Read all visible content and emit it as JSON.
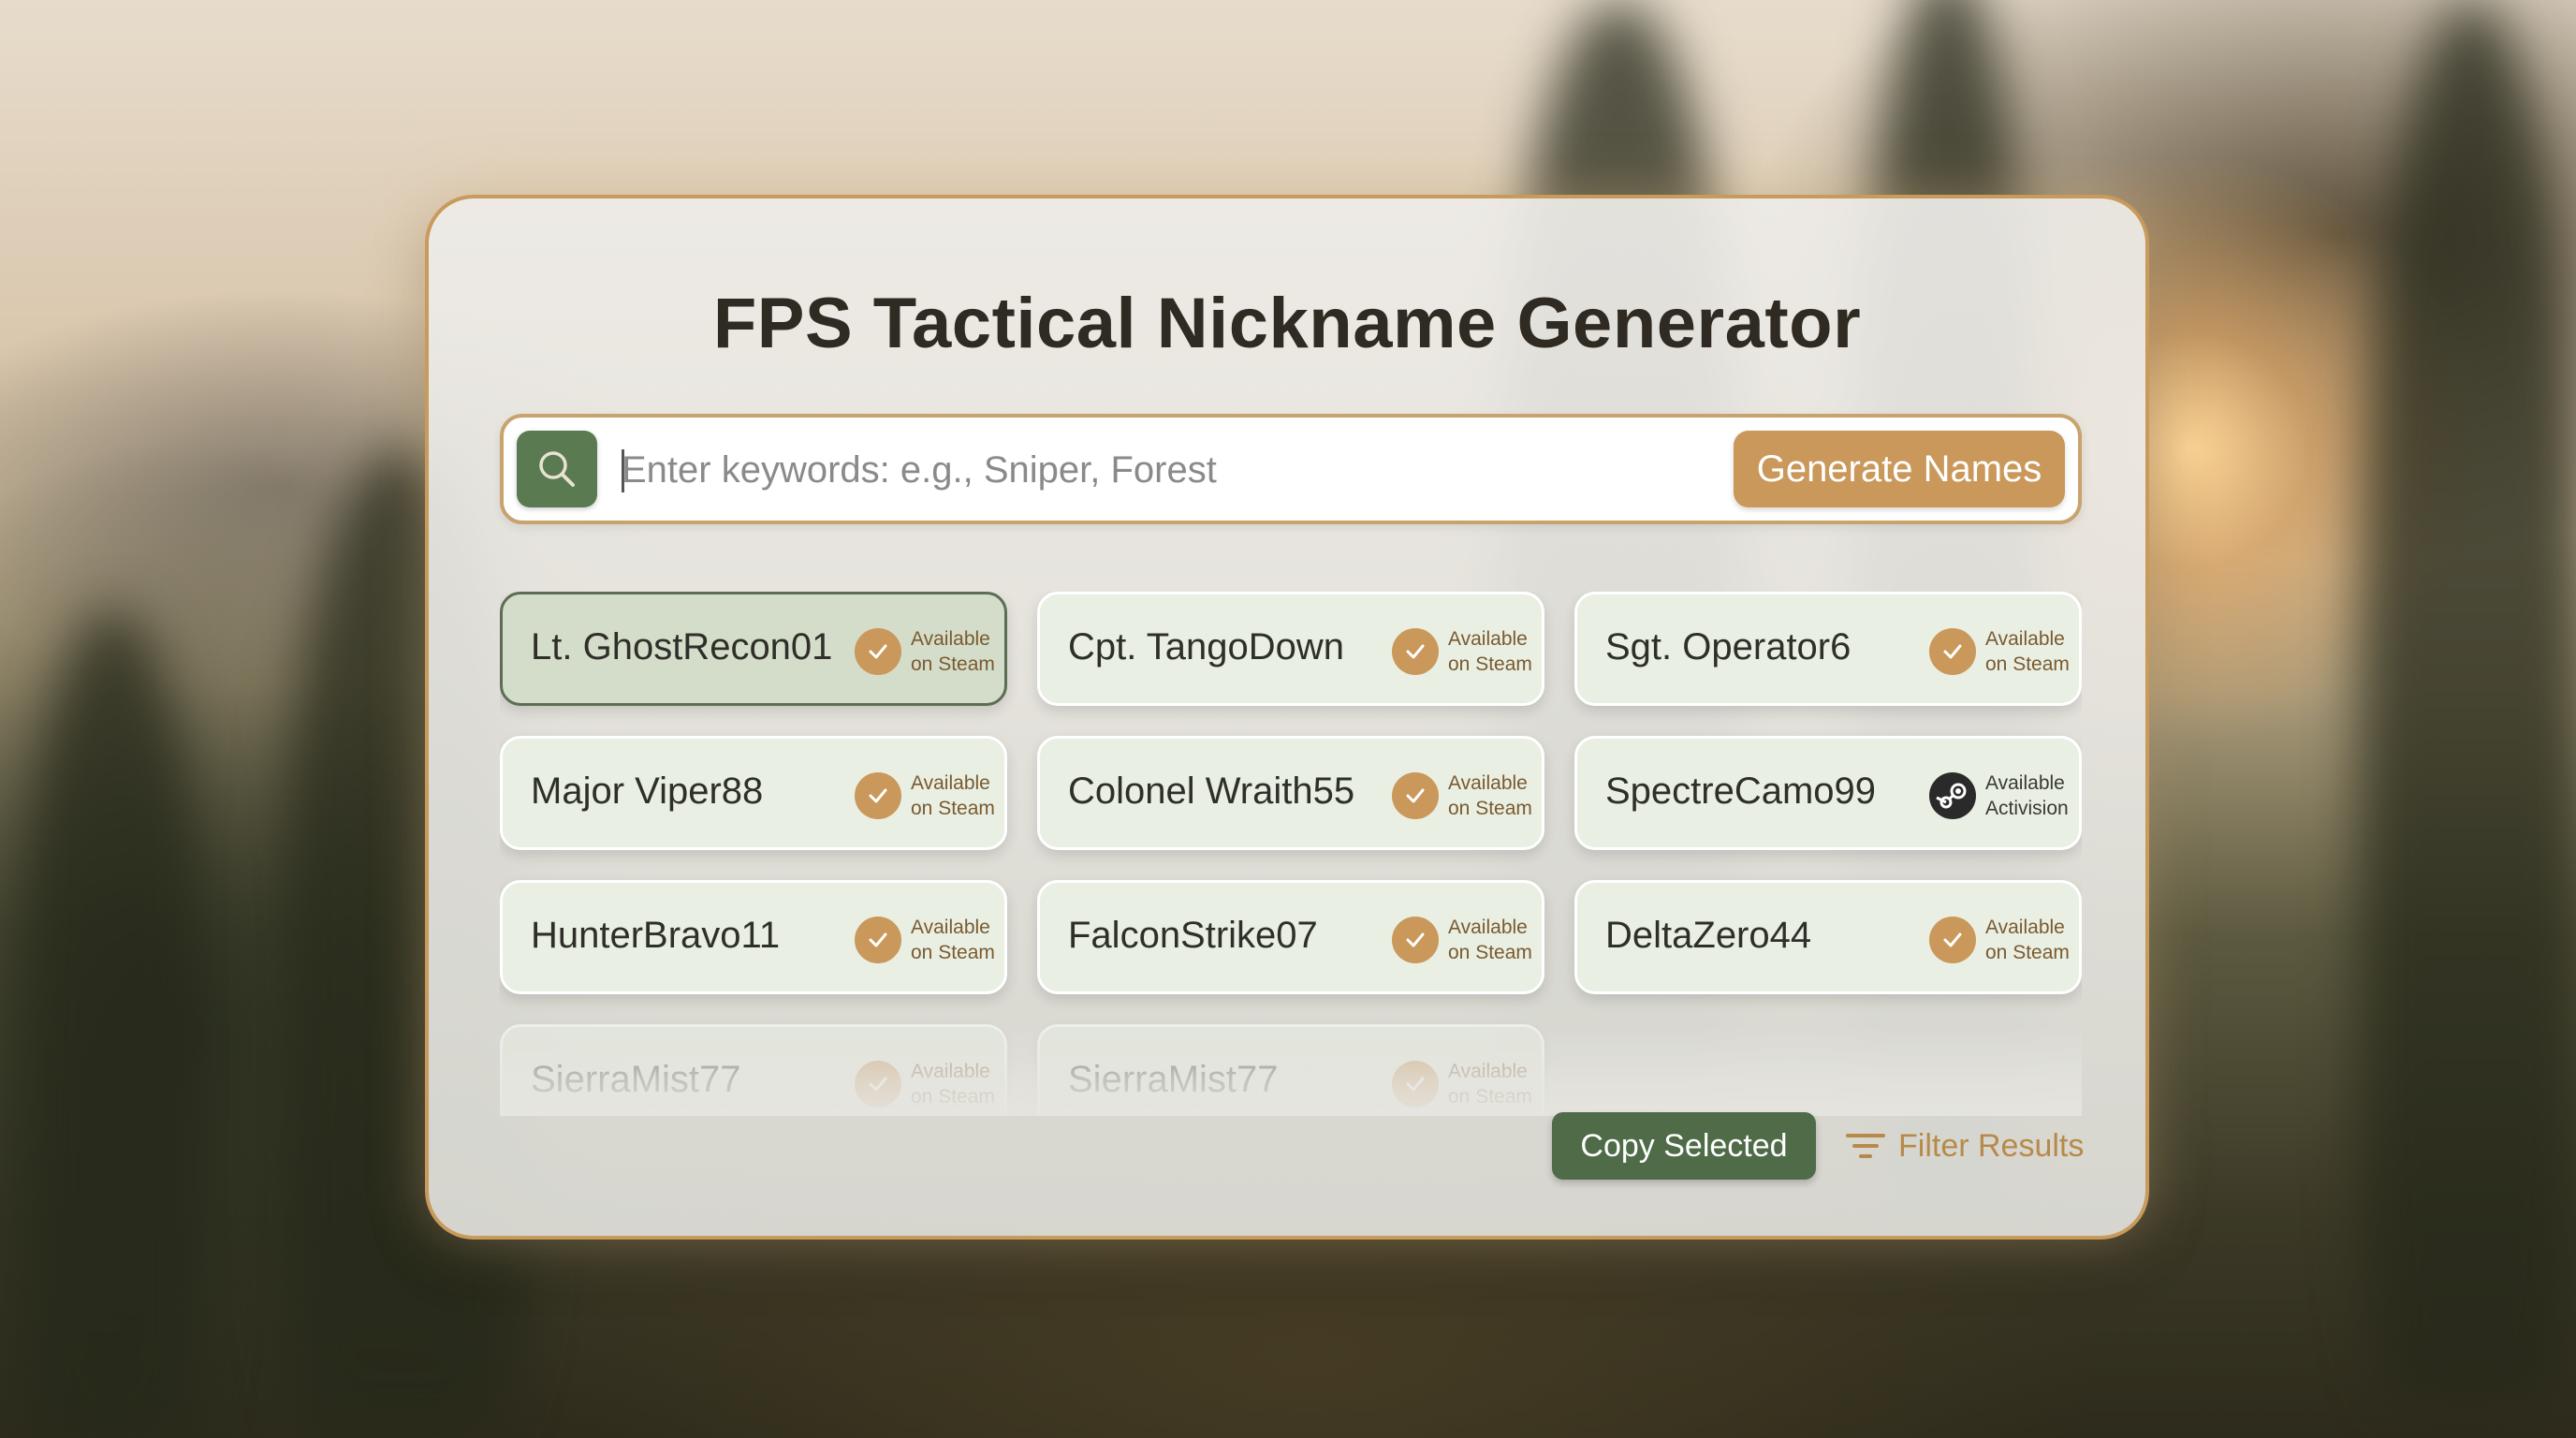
{
  "app": {
    "title": "FPS Tactical Nickname Generator"
  },
  "search": {
    "placeholder": "Enter keywords: e.g., Sniper, Forest",
    "value": "",
    "icon": "search-icon",
    "generate_label": "Generate Names"
  },
  "results": [
    {
      "name": "Lt. GhostRecon01",
      "status_line1": "Available",
      "status_line2": "on Steam",
      "icon": "check-icon",
      "selected": true
    },
    {
      "name": "Cpt. TangoDown",
      "status_line1": "Available",
      "status_line2": "on Steam",
      "icon": "check-icon",
      "selected": false
    },
    {
      "name": "Sgt. Operator6",
      "status_line1": "Available",
      "status_line2": "on Steam",
      "icon": "check-icon",
      "selected": false
    },
    {
      "name": "Major Viper88",
      "status_line1": "Available",
      "status_line2": "on Steam",
      "icon": "check-icon",
      "selected": false
    },
    {
      "name": "Colonel Wraith55",
      "status_line1": "Available",
      "status_line2": "on Steam",
      "icon": "check-icon",
      "selected": false
    },
    {
      "name": "SpectreCamo99",
      "status_line1": "Available",
      "status_line2": "Activision",
      "icon": "steam-icon",
      "selected": false
    },
    {
      "name": "HunterBravo11",
      "status_line1": "Available",
      "status_line2": "on Steam",
      "icon": "check-icon",
      "selected": false
    },
    {
      "name": "FalconStrike07",
      "status_line1": "Available",
      "status_line2": "on Steam",
      "icon": "check-icon",
      "selected": false
    },
    {
      "name": "DeltaZero44",
      "status_line1": "Available",
      "status_line2": "on Steam",
      "icon": "check-icon",
      "selected": false
    },
    {
      "name": "SierraMist77",
      "status_line1": "Available",
      "status_line2": "on Steam",
      "icon": "check-icon",
      "selected": false
    },
    {
      "name": "SierraMist77",
      "status_line1": "Available",
      "status_line2": "on Steam",
      "icon": "check-icon",
      "selected": false
    }
  ],
  "actions": {
    "copy_label": "Copy Selected",
    "filter_label": "Filter Results",
    "filter_icon": "filter-icon"
  },
  "colors": {
    "accent_gold": "#c9985a",
    "accent_green": "#4f6b48",
    "card_bg": "#e9efe3",
    "selected_border": "#5b6e55"
  }
}
